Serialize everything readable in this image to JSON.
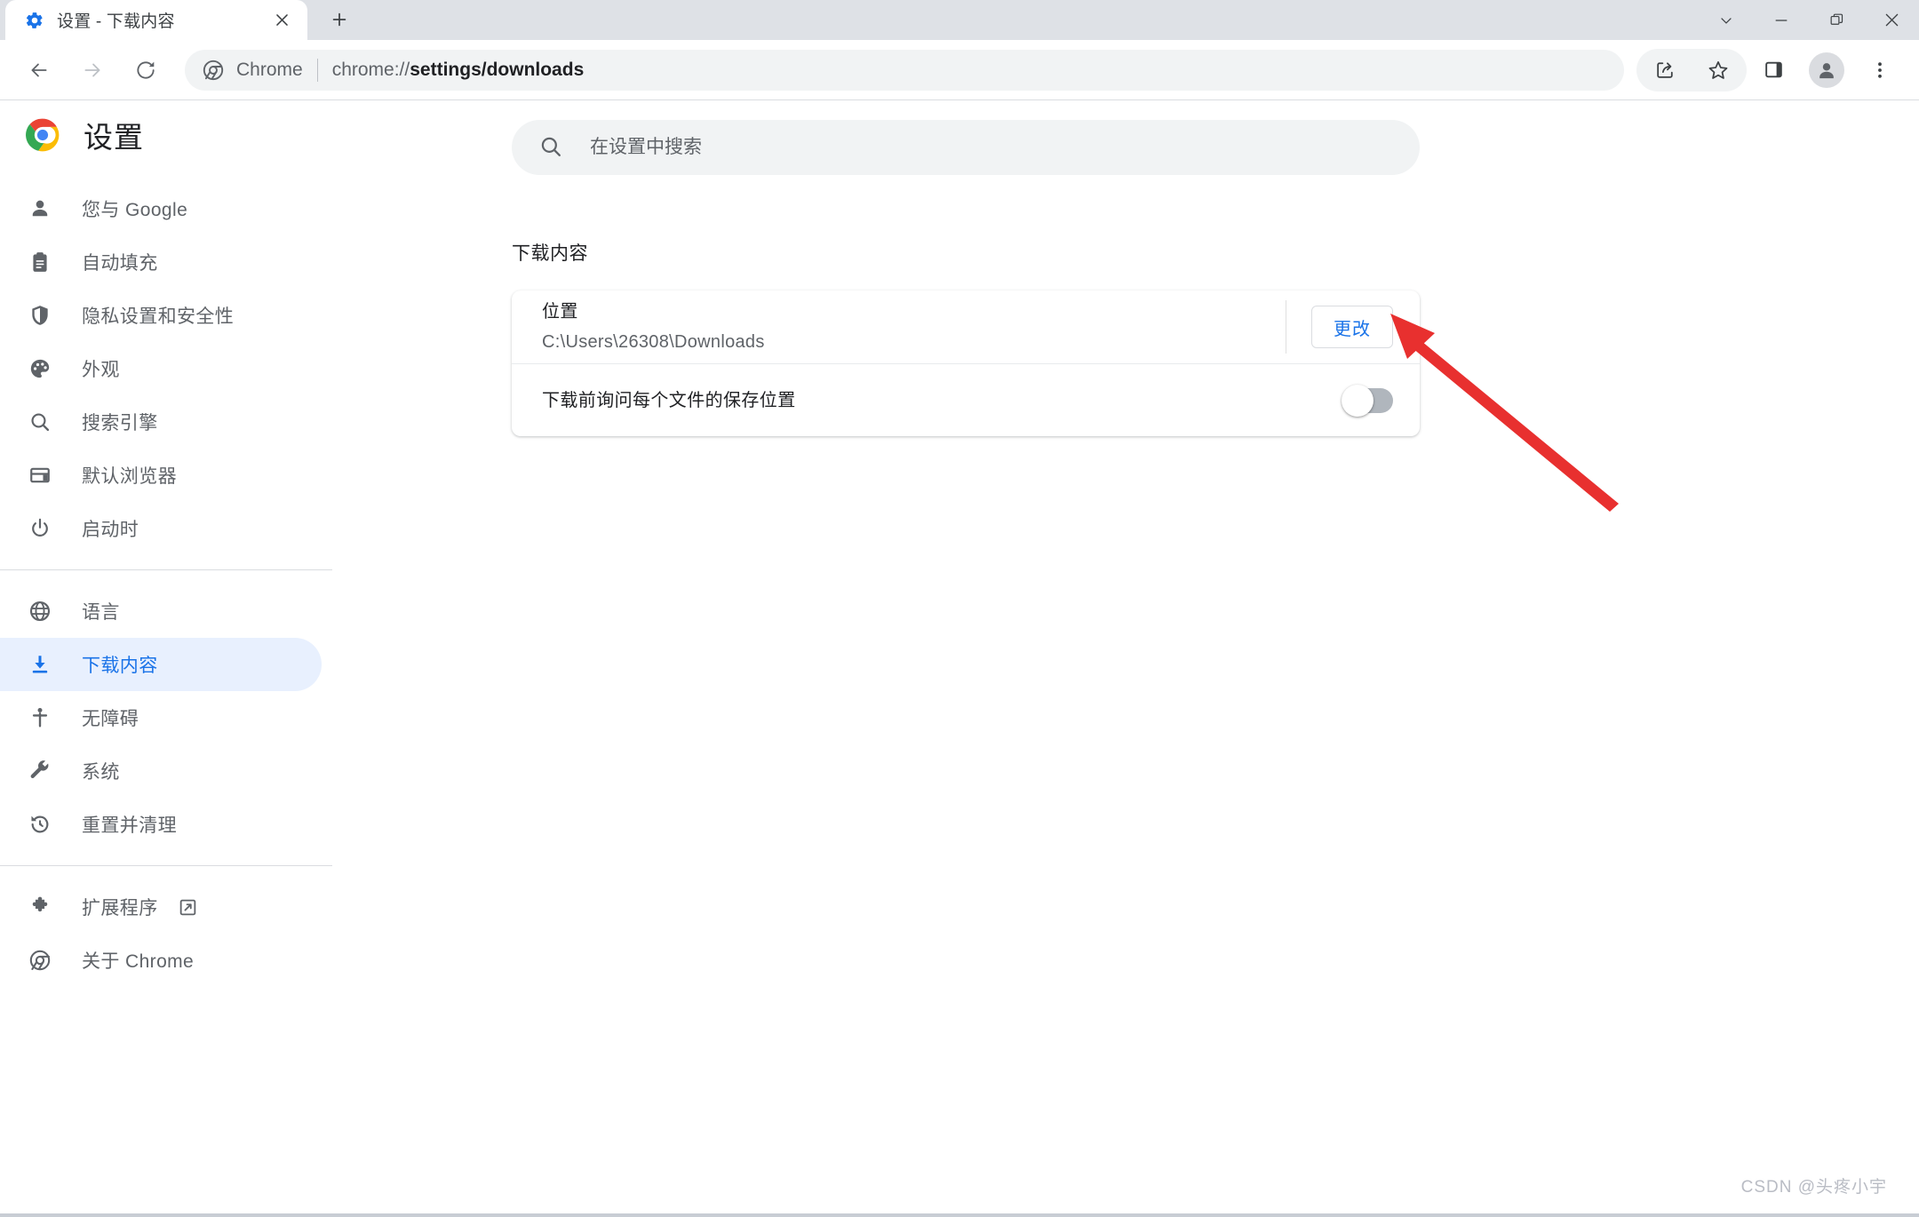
{
  "window": {
    "tab": {
      "title": "设置 - 下载内容",
      "favicon": "gear-icon",
      "close_label": "×"
    },
    "new_tab_label": "+",
    "controls": {
      "tab_search": "tab-search-chevron",
      "minimize": "minimize",
      "restore": "restore",
      "close": "close"
    }
  },
  "toolbar": {
    "back": "back-arrow",
    "forward": "forward-arrow",
    "reload": "reload",
    "omnibox": {
      "chip": "Chrome",
      "url_scheme": "chrome://",
      "url_path": "settings/downloads",
      "full_url": "chrome://settings/downloads"
    },
    "share": "share-icon",
    "bookmark": "star-icon",
    "side_panel": "side-panel-icon",
    "profile": "profile-avatar",
    "menu": "three-dot-menu"
  },
  "settings": {
    "title": "设置",
    "search": {
      "placeholder": "在设置中搜索",
      "value": ""
    },
    "nav_groups": [
      {
        "items": [
          {
            "label": "您与 Google",
            "icon": "person-icon",
            "active": false
          },
          {
            "label": "自动填充",
            "icon": "clipboard-icon",
            "active": false
          },
          {
            "label": "隐私设置和安全性",
            "icon": "shield-icon",
            "active": false
          },
          {
            "label": "外观",
            "icon": "palette-icon",
            "active": false
          },
          {
            "label": "搜索引擎",
            "icon": "search-icon",
            "active": false
          },
          {
            "label": "默认浏览器",
            "icon": "browser-window-icon",
            "active": false
          },
          {
            "label": "启动时",
            "icon": "power-icon",
            "active": false
          }
        ]
      },
      {
        "items": [
          {
            "label": "语言",
            "icon": "globe-icon",
            "active": false
          },
          {
            "label": "下载内容",
            "icon": "download-icon",
            "active": true
          },
          {
            "label": "无障碍",
            "icon": "accessibility-icon",
            "active": false
          },
          {
            "label": "系统",
            "icon": "wrench-icon",
            "active": false
          },
          {
            "label": "重置并清理",
            "icon": "history-restore-icon",
            "active": false
          }
        ]
      },
      {
        "items": [
          {
            "label": "扩展程序",
            "icon": "puzzle-icon",
            "active": false,
            "external": true
          },
          {
            "label": "关于 Chrome",
            "icon": "chrome-icon",
            "active": false
          }
        ]
      }
    ]
  },
  "main": {
    "section_title": "下载内容",
    "rows": [
      {
        "label": "位置",
        "value": "C:\\Users\\26308\\Downloads",
        "button": "更改"
      },
      {
        "label": "下载前询问每个文件的保存位置",
        "toggle_state": "off"
      }
    ]
  },
  "annotation": {
    "type": "red-arrow",
    "color": "#e8302f",
    "points_to": "更改"
  },
  "watermark": "CSDN @头疼小宇",
  "colors": {
    "accent_blue": "#1a73e8",
    "active_nav_bg": "#e8f0fe",
    "tabstrip_bg": "#dee1e6",
    "field_bg": "#f1f3f4",
    "text_primary": "#202124",
    "text_secondary": "#5f6368",
    "annotation_red": "#e8302f"
  }
}
